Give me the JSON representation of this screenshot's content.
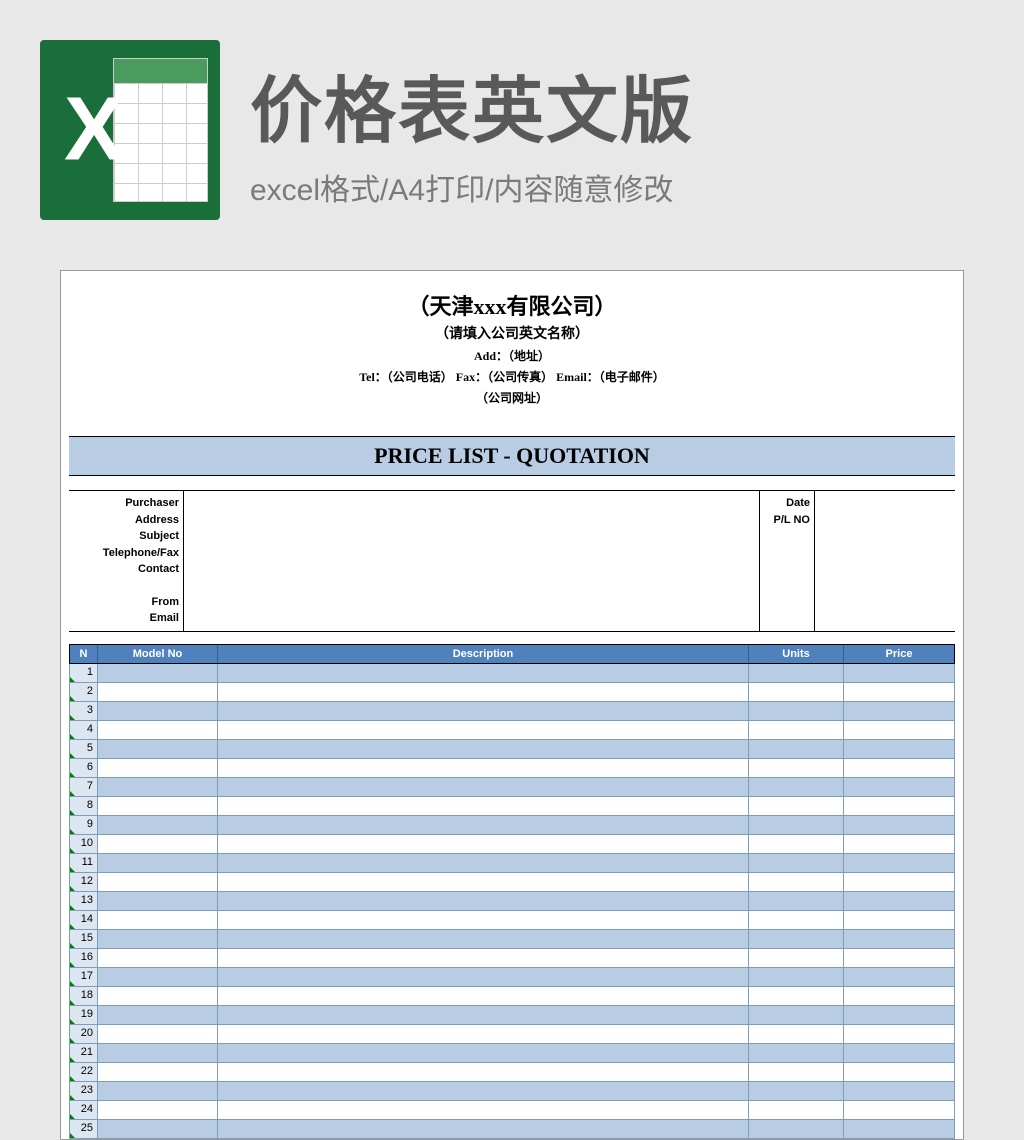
{
  "header": {
    "icon_letter": "X",
    "title": "价格表英文版",
    "subtitle": "excel格式/A4打印/内容随意修改"
  },
  "company": {
    "name": "（天津xxx有限公司）",
    "subname": "（请填入公司英文名称）",
    "addr_line": "Add：（地址）",
    "contact_line": "Tel：（公司电话）  Fax：（公司传真）  Email：（电子邮件）",
    "website": "（公司网址）"
  },
  "quote_title": "PRICE LIST - QUOTATION",
  "info_left": {
    "purchaser": "Purchaser",
    "address": "Address",
    "subject": "Subject",
    "telfax": "Telephone/Fax",
    "contact": "Contact",
    "from": "From",
    "email": "Email"
  },
  "info_right": {
    "date": "Date",
    "plno": "P/L NO"
  },
  "table_headers": {
    "n": "N",
    "model": "Model No",
    "desc": "Description",
    "units": "Units",
    "price": "Price"
  },
  "chart_data": {
    "type": "table",
    "title": "PRICE LIST - QUOTATION",
    "columns": [
      "N",
      "Model No",
      "Description",
      "Units",
      "Price"
    ],
    "rows": [
      {
        "n": "1",
        "model": "",
        "desc": "",
        "units": "",
        "price": ""
      },
      {
        "n": "2",
        "model": "",
        "desc": "",
        "units": "",
        "price": ""
      },
      {
        "n": "3",
        "model": "",
        "desc": "",
        "units": "",
        "price": ""
      },
      {
        "n": "4",
        "model": "",
        "desc": "",
        "units": "",
        "price": ""
      },
      {
        "n": "5",
        "model": "",
        "desc": "",
        "units": "",
        "price": ""
      },
      {
        "n": "6",
        "model": "",
        "desc": "",
        "units": "",
        "price": ""
      },
      {
        "n": "7",
        "model": "",
        "desc": "",
        "units": "",
        "price": ""
      },
      {
        "n": "8",
        "model": "",
        "desc": "",
        "units": "",
        "price": ""
      },
      {
        "n": "9",
        "model": "",
        "desc": "",
        "units": "",
        "price": ""
      },
      {
        "n": "10",
        "model": "",
        "desc": "",
        "units": "",
        "price": ""
      },
      {
        "n": "11",
        "model": "",
        "desc": "",
        "units": "",
        "price": ""
      },
      {
        "n": "12",
        "model": "",
        "desc": "",
        "units": "",
        "price": ""
      },
      {
        "n": "13",
        "model": "",
        "desc": "",
        "units": "",
        "price": ""
      },
      {
        "n": "14",
        "model": "",
        "desc": "",
        "units": "",
        "price": ""
      },
      {
        "n": "15",
        "model": "",
        "desc": "",
        "units": "",
        "price": ""
      },
      {
        "n": "16",
        "model": "",
        "desc": "",
        "units": "",
        "price": ""
      },
      {
        "n": "17",
        "model": "",
        "desc": "",
        "units": "",
        "price": ""
      },
      {
        "n": "18",
        "model": "",
        "desc": "",
        "units": "",
        "price": ""
      },
      {
        "n": "19",
        "model": "",
        "desc": "",
        "units": "",
        "price": ""
      },
      {
        "n": "20",
        "model": "",
        "desc": "",
        "units": "",
        "price": ""
      },
      {
        "n": "21",
        "model": "",
        "desc": "",
        "units": "",
        "price": ""
      },
      {
        "n": "22",
        "model": "",
        "desc": "",
        "units": "",
        "price": ""
      },
      {
        "n": "23",
        "model": "",
        "desc": "",
        "units": "",
        "price": ""
      },
      {
        "n": "24",
        "model": "",
        "desc": "",
        "units": "",
        "price": ""
      },
      {
        "n": "25",
        "model": "",
        "desc": "",
        "units": "",
        "price": ""
      }
    ]
  }
}
